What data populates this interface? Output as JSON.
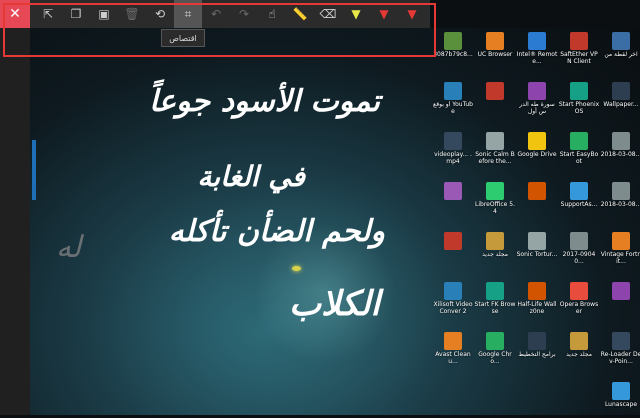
{
  "toolbar": {
    "close_glyph": "✕",
    "tooltip": "اقتصاص",
    "buttons": [
      {
        "name": "share-icon",
        "glyph": "⇱",
        "dim": false
      },
      {
        "name": "copy-icon",
        "glyph": "❐",
        "dim": false
      },
      {
        "name": "save-icon",
        "glyph": "▣",
        "dim": false
      },
      {
        "name": "delete-icon",
        "glyph": "🗑",
        "dim": true
      },
      {
        "name": "history-icon",
        "glyph": "⟲",
        "dim": false
      },
      {
        "name": "crop-icon",
        "glyph": "⌗",
        "dim": false
      },
      {
        "name": "undo-icon",
        "glyph": "↶",
        "dim": true
      },
      {
        "name": "redo-icon",
        "glyph": "↷",
        "dim": true
      },
      {
        "name": "touch-writing-icon",
        "glyph": "☝",
        "dim": false
      },
      {
        "name": "ruler-icon",
        "glyph": "📏",
        "dim": false
      },
      {
        "name": "eraser-icon",
        "glyph": "⌫",
        "dim": false
      },
      {
        "name": "highlighter-icon",
        "glyph": "▼",
        "dim": false
      },
      {
        "name": "pencil-icon",
        "glyph": "▼",
        "dim": false
      },
      {
        "name": "pen-icon",
        "glyph": "▼",
        "dim": false
      }
    ]
  },
  "poem": {
    "line1": "تموت الأسود جوعاً",
    "line2": "في الغابة",
    "line3": "ولحم الضأن تأكله",
    "line4": "الكلاب",
    "ghost": "له"
  },
  "desktop_icons": [
    {
      "label": "آخر لقطة من",
      "color": "#3a6ea5"
    },
    {
      "label": "SaftEther VPN Client",
      "color": "#c0392b"
    },
    {
      "label": "Intel® Remote...",
      "color": "#2a7bd1"
    },
    {
      "label": "UC Browser",
      "color": "#e67e22"
    },
    {
      "label": "3087b79c8...",
      "color": "#5a8f3c"
    },
    {
      "label": "Wallpaper...",
      "color": "#2c3e50"
    },
    {
      "label": "Start Phoenix OS",
      "color": "#16a085"
    },
    {
      "label": "سورة طه الدرس أول",
      "color": "#8e44ad"
    },
    {
      "label": "",
      "color": "#c0392b"
    },
    {
      "label": "أو بوقع YouTube",
      "color": "#2980b9"
    },
    {
      "label": "2018-03-08...",
      "color": "#7f8c8d"
    },
    {
      "label": "Start EasyBoot",
      "color": "#27ae60"
    },
    {
      "label": "Google Drive",
      "color": "#f1c40f"
    },
    {
      "label": "Sonic Calm Before the...",
      "color": "#95a5a6"
    },
    {
      "label": "videoplay... .mp4",
      "color": "#34495e"
    },
    {
      "label": "2018-03-08...",
      "color": "#7f8c8d"
    },
    {
      "label": "SupportAs...",
      "color": "#3498db"
    },
    {
      "label": "",
      "color": "#d35400"
    },
    {
      "label": "LibreOffice 5.4",
      "color": "#2ecc71"
    },
    {
      "label": "",
      "color": "#9b59b6"
    },
    {
      "label": "Vintage Fortnit...",
      "color": "#e67e22"
    },
    {
      "label": "2017-09040...",
      "color": "#7f8c8d"
    },
    {
      "label": "Sonic Tortur...",
      "color": "#95a5a6"
    },
    {
      "label": "مجلد جديد",
      "color": "#c49a3a"
    },
    {
      "label": "",
      "color": "#c0392b"
    },
    {
      "label": "",
      "color": "#8e44ad"
    },
    {
      "label": "Opera Browser",
      "color": "#e74c3c"
    },
    {
      "label": "Half-Life Wallz0ne",
      "color": "#d35400"
    },
    {
      "label": "Start FK Browse",
      "color": "#16a085"
    },
    {
      "label": "Xilisoft Video Conver 2",
      "color": "#2980b9"
    },
    {
      "label": "Re-Loader Dev-Poin...",
      "color": "#34495e"
    },
    {
      "label": "مجلد جديد",
      "color": "#c49a3a"
    },
    {
      "label": "برامج التخطيط",
      "color": "#2c3e50"
    },
    {
      "label": "Google Chro...",
      "color": "#27ae60"
    },
    {
      "label": "Avast Cleanu...",
      "color": "#e67e22"
    },
    {
      "label": "Lunascape",
      "color": "#3498db"
    }
  ]
}
